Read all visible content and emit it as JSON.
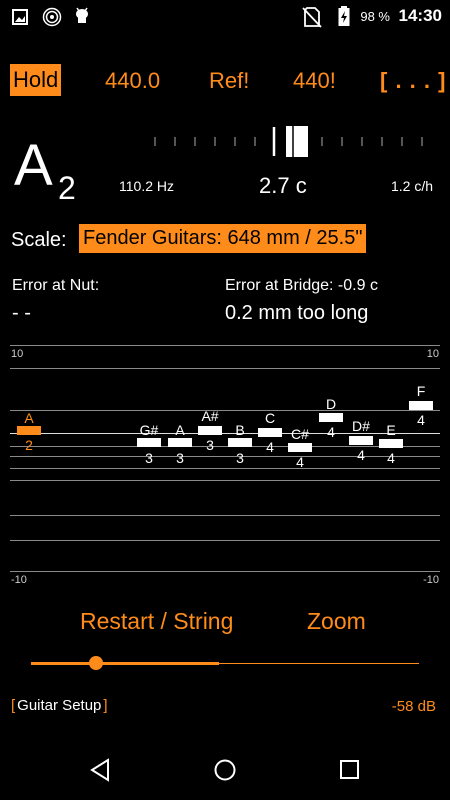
{
  "status_bar": {
    "battery": "98 %",
    "time": "14:30",
    "icons": [
      "image-icon",
      "radio-icon",
      "android-icon",
      "no-sim-icon",
      "battery-charging-icon"
    ]
  },
  "toolbar": {
    "hold": "Hold",
    "freq": "440.0",
    "ref": "Ref!",
    "freq2": "440!",
    "more": "[ . . . ]"
  },
  "note": {
    "letter": "A",
    "octave": "2",
    "hz": "110.2 Hz",
    "cents": "2.7 c",
    "rate": "1.2 c/h"
  },
  "scale": {
    "label": "Scale:",
    "value": "Fender Guitars: 648 mm / 25.5\""
  },
  "errors": {
    "nut_label": "Error at Nut:",
    "nut_value": "- -",
    "bridge_label": "Error at Bridge: -0.9 c",
    "bridge_value": "0.2 mm too long"
  },
  "graph": {
    "top_left": "10",
    "top_right": "10",
    "bottom_left": "-10",
    "bottom_right": "-10",
    "notes": [
      {
        "name": "A",
        "octave": "2",
        "active": true
      },
      {
        "name": "G#",
        "octave": "3"
      },
      {
        "name": "A",
        "octave": "3"
      },
      {
        "name": "A#",
        "octave": "3"
      },
      {
        "name": "B",
        "octave": "3"
      },
      {
        "name": "C",
        "octave": "4"
      },
      {
        "name": "C#",
        "octave": "4"
      },
      {
        "name": "D",
        "octave": "4"
      },
      {
        "name": "D#",
        "octave": "4"
      },
      {
        "name": "E",
        "octave": "4"
      },
      {
        "name": "F",
        "octave": "4"
      }
    ]
  },
  "actions": {
    "restart": "Restart / String",
    "zoom": "Zoom"
  },
  "footer": {
    "setup": "Guitar Setup",
    "level": "-58 dB"
  },
  "colors": {
    "accent": "#ff8c1a",
    "background": "#000000"
  }
}
